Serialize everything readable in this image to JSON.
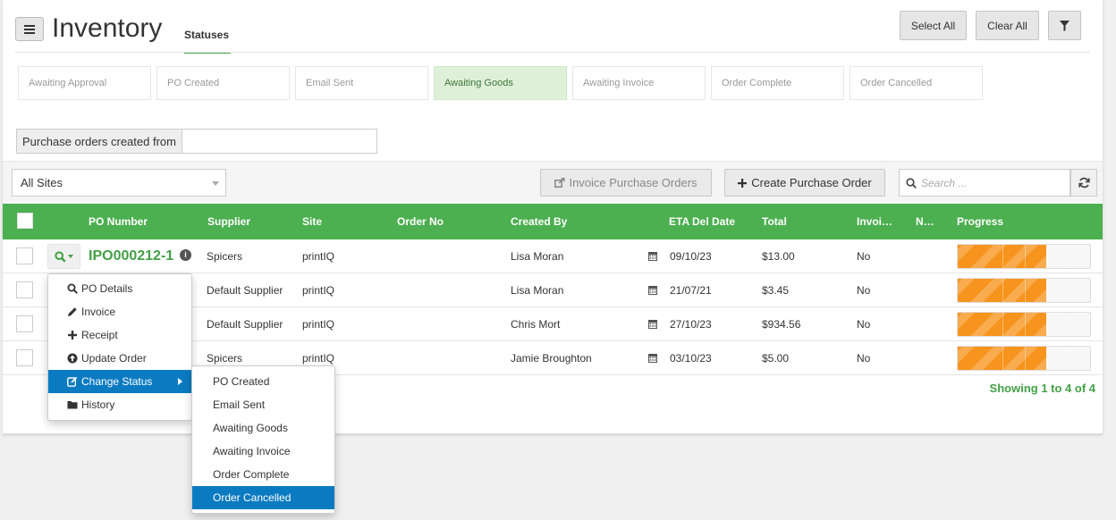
{
  "header": {
    "title": "Inventory",
    "tab": "Statuses",
    "select_all": "Select All",
    "clear_all": "Clear All"
  },
  "statuses": [
    {
      "label": "Awaiting Approval",
      "active": false
    },
    {
      "label": "PO Created",
      "active": false
    },
    {
      "label": "Email Sent",
      "active": false
    },
    {
      "label": "Awaiting Goods",
      "active": true
    },
    {
      "label": "Awaiting Invoice",
      "active": false
    },
    {
      "label": "Order Complete",
      "active": false
    },
    {
      "label": "Order Cancelled",
      "active": false
    }
  ],
  "filter": {
    "created_from_label": "Purchase orders created from",
    "created_from_value": ""
  },
  "toolbar": {
    "sites_selected": "All Sites",
    "invoice_button": "Invoice Purchase Orders",
    "create_button": "Create Purchase Order",
    "search_placeholder": "Search ..."
  },
  "table": {
    "columns": [
      "PO Number",
      "Supplier",
      "Site",
      "Order No",
      "Created By",
      "ETA Del Date",
      "Total",
      "Invoi…",
      "N…",
      "Progress"
    ],
    "rows": [
      {
        "po": "IPO000212-1",
        "supplier": "Spicers",
        "site": "printIQ",
        "order_no": "",
        "created_by": "Lisa Moran",
        "eta": "09/10/23",
        "total": "$13.00",
        "invoiced": "No",
        "progress": 0.67
      },
      {
        "po": "",
        "supplier": "Default Supplier",
        "site": "printIQ",
        "order_no": "",
        "created_by": "Lisa Moran",
        "eta": "21/07/21",
        "total": "$3.45",
        "invoiced": "No",
        "progress": 0.67
      },
      {
        "po": "",
        "supplier": "Default Supplier",
        "site": "printIQ",
        "order_no": "",
        "created_by": "Chris Mort",
        "eta": "27/10/23",
        "total": "$934.56",
        "invoiced": "No",
        "progress": 0.67
      },
      {
        "po": "",
        "supplier": "Spicers",
        "site": "printIQ",
        "order_no": "",
        "created_by": "Jamie Broughton",
        "eta": "03/10/23",
        "total": "$5.00",
        "invoiced": "No",
        "progress": 0.67
      }
    ],
    "showing": "Showing 1 to 4 of 4"
  },
  "context_menu": {
    "items": [
      {
        "label": "PO Details",
        "icon": "search-icon"
      },
      {
        "label": "Invoice",
        "icon": "pencil-icon"
      },
      {
        "label": "Receipt",
        "icon": "plus-icon"
      },
      {
        "label": "Update Order",
        "icon": "arrow-circle-icon"
      },
      {
        "label": "Change Status",
        "icon": "edit-icon"
      },
      {
        "label": "History",
        "icon": "folder-icon"
      }
    ],
    "submenu": [
      "PO Created",
      "Email Sent",
      "Awaiting Goods",
      "Awaiting Invoice",
      "Order Complete",
      "Order Cancelled"
    ]
  },
  "colors": {
    "accent_green": "#4caf50",
    "link_green": "#43a047",
    "progress_orange": "#f7941d",
    "menu_active_blue": "#0b7bc1"
  }
}
